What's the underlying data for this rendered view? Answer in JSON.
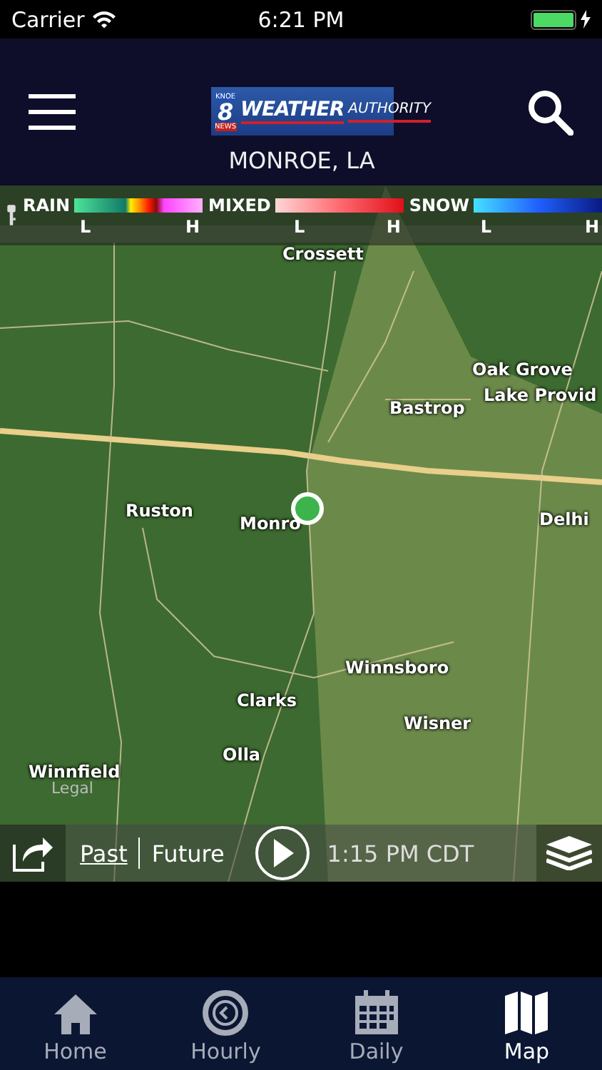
{
  "status_bar": {
    "carrier": "Carrier",
    "time": "6:21 PM"
  },
  "header": {
    "logo": {
      "badge_top": "KNOE",
      "badge_number": "8",
      "badge_bottom": "NEWS",
      "title": "WEATHER",
      "subtitle": "AUTHORITY"
    },
    "location": "MONROE, LA"
  },
  "legend": [
    {
      "label": "RAIN",
      "low": "L",
      "high": "H",
      "kind": "rain"
    },
    {
      "label": "MIXED",
      "low": "L",
      "high": "H",
      "kind": "mixed"
    },
    {
      "label": "SNOW",
      "low": "L",
      "high": "H",
      "kind": "snow"
    }
  ],
  "map": {
    "labels": [
      "Crossett",
      "Oak Grove",
      "Lake Provid",
      "Bastrop",
      "Ruston",
      "Monro",
      "Delhi",
      "Winnsboro",
      "Clarks",
      "Wisner",
      "Olla",
      "Winnfield"
    ],
    "legal": "Legal"
  },
  "playback": {
    "modes": [
      {
        "label": "Past",
        "selected": true
      },
      {
        "label": "Future",
        "selected": false
      }
    ],
    "time": "1:15 PM CDT"
  },
  "tabs": [
    {
      "label": "Home",
      "selected": false,
      "kind": "home"
    },
    {
      "label": "Hourly",
      "selected": false,
      "kind": "clock"
    },
    {
      "label": "Daily",
      "selected": false,
      "kind": "calendar"
    },
    {
      "label": "Map",
      "selected": true,
      "kind": "map"
    }
  ]
}
